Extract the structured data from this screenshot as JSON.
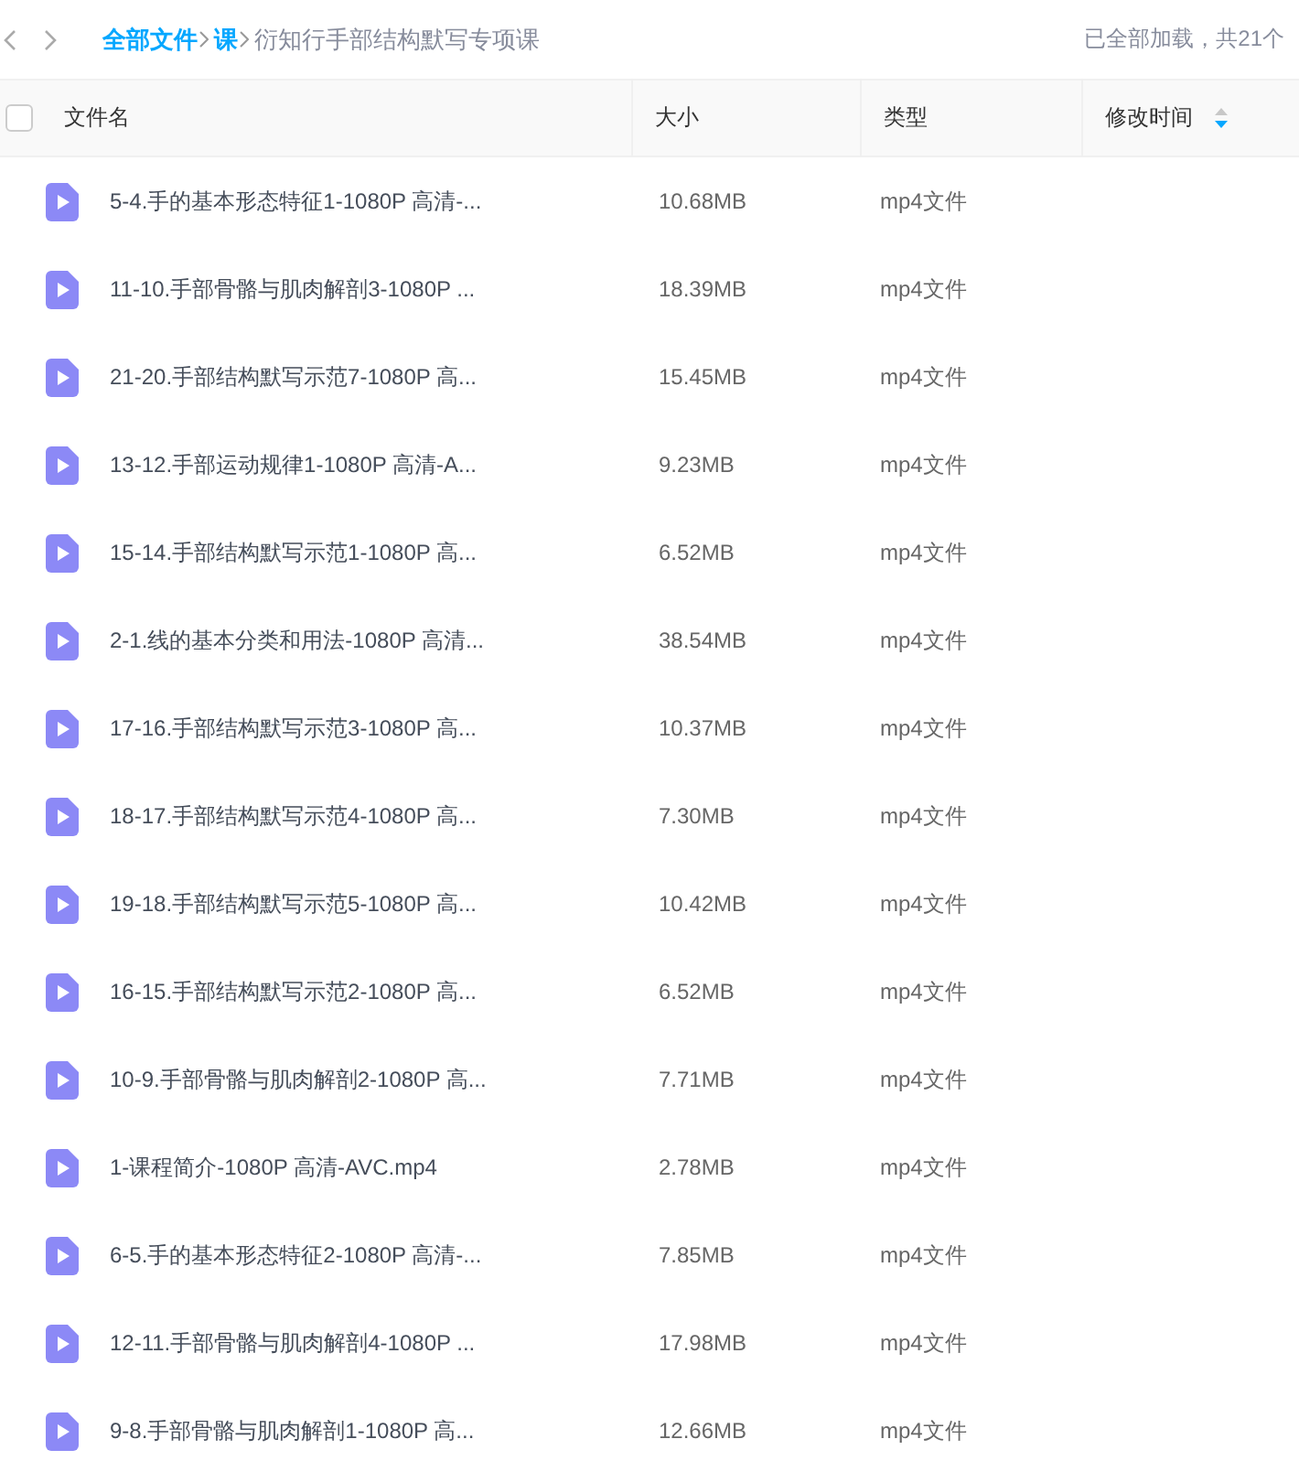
{
  "breadcrumb": [
    {
      "label": "全部文件",
      "kind": "link"
    },
    {
      "label": "课",
      "kind": "link"
    },
    {
      "label": "衍知行手部结构默写专项课",
      "kind": "current"
    }
  ],
  "status": "已全部加载，共21个",
  "table": {
    "select_all": {
      "checked": false
    },
    "columns": [
      "文件名",
      "大小",
      "类型",
      "修改时间"
    ],
    "rows": [
      {
        "name": "5-4.手的基本形态特征1-1080P 高清-...",
        "size": "10.68MB",
        "type": "mp4文件"
      },
      {
        "name": "11-10.手部骨骼与肌肉解剖3-1080P ...",
        "size": "18.39MB",
        "type": "mp4文件"
      },
      {
        "name": "21-20.手部结构默写示范7-1080P 高...",
        "size": "15.45MB",
        "type": "mp4文件"
      },
      {
        "name": "13-12.手部运动规律1-1080P 高清-A...",
        "size": "9.23MB",
        "type": "mp4文件"
      },
      {
        "name": "15-14.手部结构默写示范1-1080P 高...",
        "size": "6.52MB",
        "type": "mp4文件"
      },
      {
        "name": "2-1.线的基本分类和用法-1080P 高清...",
        "size": "38.54MB",
        "type": "mp4文件"
      },
      {
        "name": "17-16.手部结构默写示范3-1080P 高...",
        "size": "10.37MB",
        "type": "mp4文件"
      },
      {
        "name": "18-17.手部结构默写示范4-1080P 高...",
        "size": "7.30MB",
        "type": "mp4文件"
      },
      {
        "name": "19-18.手部结构默写示范5-1080P 高...",
        "size": "10.42MB",
        "type": "mp4文件"
      },
      {
        "name": "16-15.手部结构默写示范2-1080P 高...",
        "size": "6.52MB",
        "type": "mp4文件"
      },
      {
        "name": "10-9.手部骨骼与肌肉解剖2-1080P 高...",
        "size": "7.71MB",
        "type": "mp4文件"
      },
      {
        "name": "1-课程简介-1080P 高清-AVC.mp4",
        "size": "2.78MB",
        "type": "mp4文件"
      },
      {
        "name": "6-5.手的基本形态特征2-1080P 高清-...",
        "size": "7.85MB",
        "type": "mp4文件"
      },
      {
        "name": "12-11.手部骨骼与肌肉解剖4-1080P ...",
        "size": "17.98MB",
        "type": "mp4文件"
      },
      {
        "name": "9-8.手部骨骼与肌肉解剖1-1080P 高...",
        "size": "12.66MB",
        "type": "mp4文件"
      }
    ]
  }
}
